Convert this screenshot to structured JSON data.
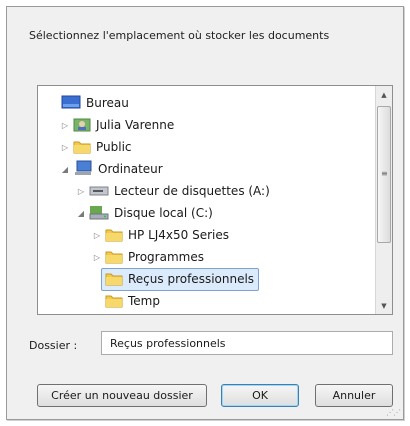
{
  "prompt": "Sélectionnez l'emplacement où stocker les documents",
  "tree": {
    "items": [
      {
        "label": "Bureau",
        "icon": "desktop-icon",
        "expander": ""
      },
      {
        "label": "Julia Varenne",
        "icon": "user-folder-icon",
        "expander": "▷"
      },
      {
        "label": "Public",
        "icon": "folder-icon",
        "expander": "▷"
      },
      {
        "label": "Ordinateur",
        "icon": "computer-icon",
        "expander": "◢"
      },
      {
        "label": "Lecteur de disquettes (A:)",
        "icon": "floppy-drive-icon",
        "expander": "▷"
      },
      {
        "label": "Disque local (C:)",
        "icon": "hard-drive-icon",
        "expander": "◢"
      },
      {
        "label": "HP LJ4x50 Series",
        "icon": "folder-icon",
        "expander": "▷"
      },
      {
        "label": "Programmes",
        "icon": "folder-icon",
        "expander": "▷"
      },
      {
        "label": "Reçus professionnels",
        "icon": "folder-icon",
        "expander": "",
        "selected": true
      },
      {
        "label": "Temp",
        "icon": "folder-icon",
        "expander": ""
      }
    ],
    "scroll_up_glyph": "▲",
    "scroll_down_glyph": "▼",
    "thumb_grip_glyph": "≡"
  },
  "dossier": {
    "label": "Dossier :",
    "value": "Reçus professionnels"
  },
  "buttons": {
    "new_folder": "Créer un nouveau dossier",
    "ok": "OK",
    "cancel": "Annuler"
  },
  "colors": {
    "selection_bg": "#dcebfc",
    "selection_border": "#7da2ce",
    "folder": "#f2c94c",
    "default_button_border": "#3c7fb1"
  }
}
